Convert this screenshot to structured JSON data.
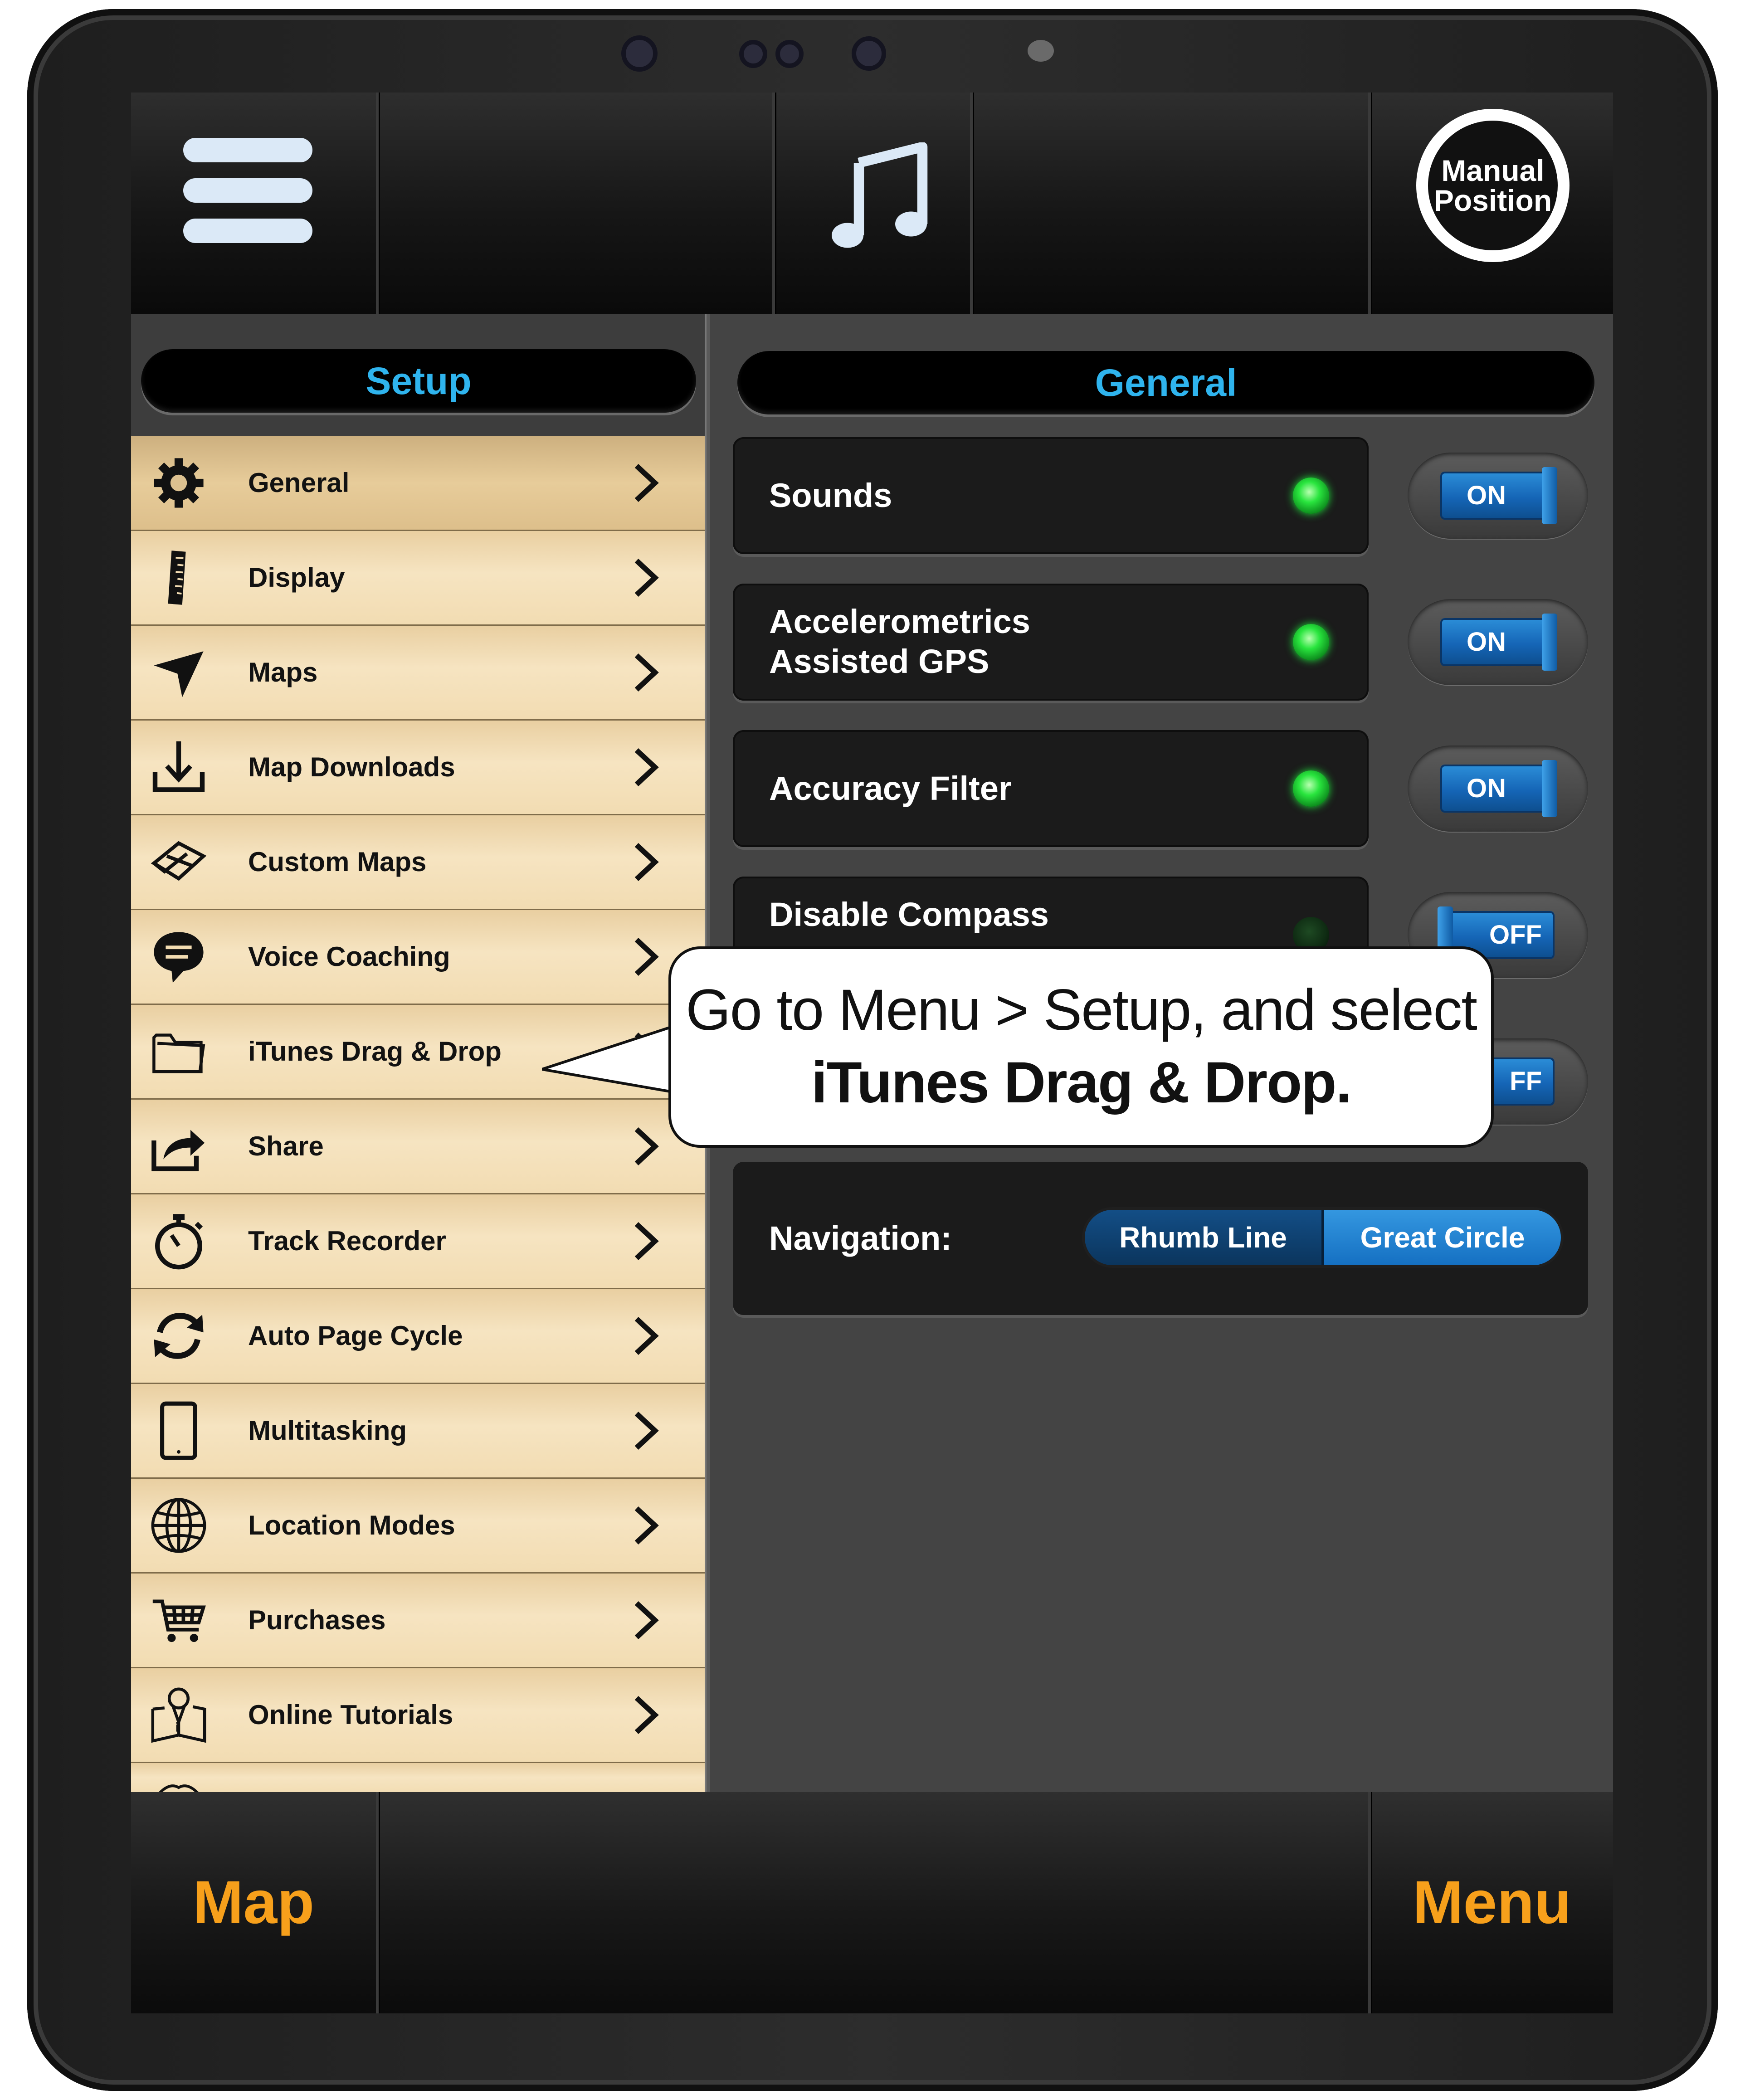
{
  "topbar": {
    "manual_position_line1": "Manual",
    "manual_position_line2": "Position"
  },
  "left_panel": {
    "header": "Setup",
    "items": [
      {
        "label": "General",
        "icon": "gear-icon"
      },
      {
        "label": "Display",
        "icon": "ruler-icon"
      },
      {
        "label": "Maps",
        "icon": "navigation-arrow-icon"
      },
      {
        "label": "Map Downloads",
        "icon": "download-icon"
      },
      {
        "label": "Custom Maps",
        "icon": "custom-map-icon"
      },
      {
        "label": "Voice Coaching",
        "icon": "speech-bubble-icon"
      },
      {
        "label": "iTunes Drag & Drop",
        "icon": "folder-icon"
      },
      {
        "label": "Share",
        "icon": "share-icon"
      },
      {
        "label": "Track Recorder",
        "icon": "stopwatch-icon"
      },
      {
        "label": "Auto Page Cycle",
        "icon": "refresh-icon"
      },
      {
        "label": "Multitasking",
        "icon": "tablet-icon"
      },
      {
        "label": "Location Modes",
        "icon": "globe-icon"
      },
      {
        "label": "Purchases",
        "icon": "cart-icon"
      },
      {
        "label": "Online Tutorials",
        "icon": "map-pin-book-icon"
      }
    ]
  },
  "right_panel": {
    "header": "General",
    "settings": [
      {
        "line1": "Sounds",
        "line2": "",
        "led": "on",
        "toggle": "ON"
      },
      {
        "line1": "Accelerometrics",
        "line2": "Assisted GPS",
        "led": "on",
        "toggle": "ON"
      },
      {
        "line1": "Accuracy Filter",
        "line2": "",
        "led": "on",
        "toggle": "ON"
      },
      {
        "line1": "Disable Compass",
        "line2": "",
        "led": "off",
        "toggle": "OFF"
      },
      {
        "line1": "",
        "line2": "",
        "led": "off",
        "toggle": "FF"
      }
    ],
    "navigation": {
      "label": "Navigation:",
      "options": [
        "Rhumb Line",
        "Great Circle"
      ],
      "selected": "Great Circle"
    }
  },
  "bottombar": {
    "map_label": "Map",
    "menu_label": "Menu"
  },
  "callout": {
    "line1": "Go to Menu > Setup, and select",
    "line2": "iTunes Drag & Drop."
  },
  "colors": {
    "accent_blue": "#2fb4ee",
    "bottom_label_orange": "#f7a01b",
    "menu_tan": "#f2dcb2",
    "toggle_blue": "#1565b6",
    "led_green": "#29e53e"
  }
}
